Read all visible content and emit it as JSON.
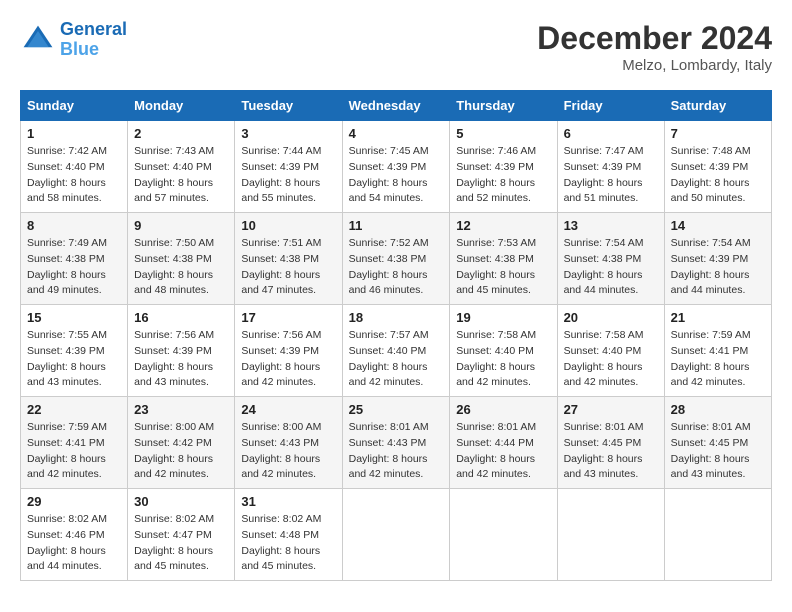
{
  "header": {
    "logo_line1": "General",
    "logo_line2": "Blue",
    "month_title": "December 2024",
    "location": "Melzo, Lombardy, Italy"
  },
  "weekdays": [
    "Sunday",
    "Monday",
    "Tuesday",
    "Wednesday",
    "Thursday",
    "Friday",
    "Saturday"
  ],
  "weeks": [
    [
      {
        "day": "1",
        "sunrise": "7:42 AM",
        "sunset": "4:40 PM",
        "daylight": "8 hours and 58 minutes."
      },
      {
        "day": "2",
        "sunrise": "7:43 AM",
        "sunset": "4:40 PM",
        "daylight": "8 hours and 57 minutes."
      },
      {
        "day": "3",
        "sunrise": "7:44 AM",
        "sunset": "4:39 PM",
        "daylight": "8 hours and 55 minutes."
      },
      {
        "day": "4",
        "sunrise": "7:45 AM",
        "sunset": "4:39 PM",
        "daylight": "8 hours and 54 minutes."
      },
      {
        "day": "5",
        "sunrise": "7:46 AM",
        "sunset": "4:39 PM",
        "daylight": "8 hours and 52 minutes."
      },
      {
        "day": "6",
        "sunrise": "7:47 AM",
        "sunset": "4:39 PM",
        "daylight": "8 hours and 51 minutes."
      },
      {
        "day": "7",
        "sunrise": "7:48 AM",
        "sunset": "4:39 PM",
        "daylight": "8 hours and 50 minutes."
      }
    ],
    [
      {
        "day": "8",
        "sunrise": "7:49 AM",
        "sunset": "4:38 PM",
        "daylight": "8 hours and 49 minutes."
      },
      {
        "day": "9",
        "sunrise": "7:50 AM",
        "sunset": "4:38 PM",
        "daylight": "8 hours and 48 minutes."
      },
      {
        "day": "10",
        "sunrise": "7:51 AM",
        "sunset": "4:38 PM",
        "daylight": "8 hours and 47 minutes."
      },
      {
        "day": "11",
        "sunrise": "7:52 AM",
        "sunset": "4:38 PM",
        "daylight": "8 hours and 46 minutes."
      },
      {
        "day": "12",
        "sunrise": "7:53 AM",
        "sunset": "4:38 PM",
        "daylight": "8 hours and 45 minutes."
      },
      {
        "day": "13",
        "sunrise": "7:54 AM",
        "sunset": "4:38 PM",
        "daylight": "8 hours and 44 minutes."
      },
      {
        "day": "14",
        "sunrise": "7:54 AM",
        "sunset": "4:39 PM",
        "daylight": "8 hours and 44 minutes."
      }
    ],
    [
      {
        "day": "15",
        "sunrise": "7:55 AM",
        "sunset": "4:39 PM",
        "daylight": "8 hours and 43 minutes."
      },
      {
        "day": "16",
        "sunrise": "7:56 AM",
        "sunset": "4:39 PM",
        "daylight": "8 hours and 43 minutes."
      },
      {
        "day": "17",
        "sunrise": "7:56 AM",
        "sunset": "4:39 PM",
        "daylight": "8 hours and 42 minutes."
      },
      {
        "day": "18",
        "sunrise": "7:57 AM",
        "sunset": "4:40 PM",
        "daylight": "8 hours and 42 minutes."
      },
      {
        "day": "19",
        "sunrise": "7:58 AM",
        "sunset": "4:40 PM",
        "daylight": "8 hours and 42 minutes."
      },
      {
        "day": "20",
        "sunrise": "7:58 AM",
        "sunset": "4:40 PM",
        "daylight": "8 hours and 42 minutes."
      },
      {
        "day": "21",
        "sunrise": "7:59 AM",
        "sunset": "4:41 PM",
        "daylight": "8 hours and 42 minutes."
      }
    ],
    [
      {
        "day": "22",
        "sunrise": "7:59 AM",
        "sunset": "4:41 PM",
        "daylight": "8 hours and 42 minutes."
      },
      {
        "day": "23",
        "sunrise": "8:00 AM",
        "sunset": "4:42 PM",
        "daylight": "8 hours and 42 minutes."
      },
      {
        "day": "24",
        "sunrise": "8:00 AM",
        "sunset": "4:43 PM",
        "daylight": "8 hours and 42 minutes."
      },
      {
        "day": "25",
        "sunrise": "8:01 AM",
        "sunset": "4:43 PM",
        "daylight": "8 hours and 42 minutes."
      },
      {
        "day": "26",
        "sunrise": "8:01 AM",
        "sunset": "4:44 PM",
        "daylight": "8 hours and 42 minutes."
      },
      {
        "day": "27",
        "sunrise": "8:01 AM",
        "sunset": "4:45 PM",
        "daylight": "8 hours and 43 minutes."
      },
      {
        "day": "28",
        "sunrise": "8:01 AM",
        "sunset": "4:45 PM",
        "daylight": "8 hours and 43 minutes."
      }
    ],
    [
      {
        "day": "29",
        "sunrise": "8:02 AM",
        "sunset": "4:46 PM",
        "daylight": "8 hours and 44 minutes."
      },
      {
        "day": "30",
        "sunrise": "8:02 AM",
        "sunset": "4:47 PM",
        "daylight": "8 hours and 45 minutes."
      },
      {
        "day": "31",
        "sunrise": "8:02 AM",
        "sunset": "4:48 PM",
        "daylight": "8 hours and 45 minutes."
      },
      null,
      null,
      null,
      null
    ]
  ]
}
